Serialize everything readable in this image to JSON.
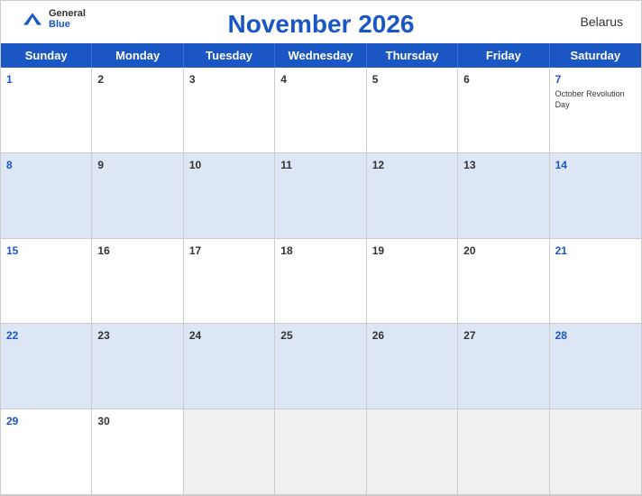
{
  "header": {
    "title": "November 2026",
    "country": "Belarus",
    "logo": {
      "general": "General",
      "blue": "Blue"
    }
  },
  "days": {
    "headers": [
      "Sunday",
      "Monday",
      "Tuesday",
      "Wednesday",
      "Thursday",
      "Friday",
      "Saturday"
    ]
  },
  "weeks": [
    {
      "id": "week1",
      "cells": [
        {
          "date": "1",
          "day": "sunday",
          "events": []
        },
        {
          "date": "2",
          "day": "monday",
          "events": []
        },
        {
          "date": "3",
          "day": "tuesday",
          "events": []
        },
        {
          "date": "4",
          "day": "wednesday",
          "events": []
        },
        {
          "date": "5",
          "day": "thursday",
          "events": []
        },
        {
          "date": "6",
          "day": "friday",
          "events": []
        },
        {
          "date": "7",
          "day": "saturday",
          "events": [
            "October Revolution Day"
          ]
        }
      ]
    },
    {
      "id": "week2",
      "cells": [
        {
          "date": "8",
          "day": "sunday",
          "events": []
        },
        {
          "date": "9",
          "day": "monday",
          "events": []
        },
        {
          "date": "10",
          "day": "tuesday",
          "events": []
        },
        {
          "date": "11",
          "day": "wednesday",
          "events": []
        },
        {
          "date": "12",
          "day": "thursday",
          "events": []
        },
        {
          "date": "13",
          "day": "friday",
          "events": []
        },
        {
          "date": "14",
          "day": "saturday",
          "events": []
        }
      ]
    },
    {
      "id": "week3",
      "cells": [
        {
          "date": "15",
          "day": "sunday",
          "events": []
        },
        {
          "date": "16",
          "day": "monday",
          "events": []
        },
        {
          "date": "17",
          "day": "tuesday",
          "events": []
        },
        {
          "date": "18",
          "day": "wednesday",
          "events": []
        },
        {
          "date": "19",
          "day": "thursday",
          "events": []
        },
        {
          "date": "20",
          "day": "friday",
          "events": []
        },
        {
          "date": "21",
          "day": "saturday",
          "events": []
        }
      ]
    },
    {
      "id": "week4",
      "cells": [
        {
          "date": "22",
          "day": "sunday",
          "events": []
        },
        {
          "date": "23",
          "day": "monday",
          "events": []
        },
        {
          "date": "24",
          "day": "tuesday",
          "events": []
        },
        {
          "date": "25",
          "day": "wednesday",
          "events": []
        },
        {
          "date": "26",
          "day": "thursday",
          "events": []
        },
        {
          "date": "27",
          "day": "friday",
          "events": []
        },
        {
          "date": "28",
          "day": "saturday",
          "events": []
        }
      ]
    },
    {
      "id": "week5",
      "cells": [
        {
          "date": "29",
          "day": "sunday",
          "events": []
        },
        {
          "date": "30",
          "day": "monday",
          "events": []
        },
        {
          "date": "",
          "day": "empty",
          "events": []
        },
        {
          "date": "",
          "day": "empty",
          "events": []
        },
        {
          "date": "",
          "day": "empty",
          "events": []
        },
        {
          "date": "",
          "day": "empty",
          "events": []
        },
        {
          "date": "",
          "day": "empty",
          "events": []
        }
      ]
    }
  ],
  "colors": {
    "blue": "#1a56c4",
    "lightBlue": "#dce6f5",
    "white": "#ffffff"
  }
}
